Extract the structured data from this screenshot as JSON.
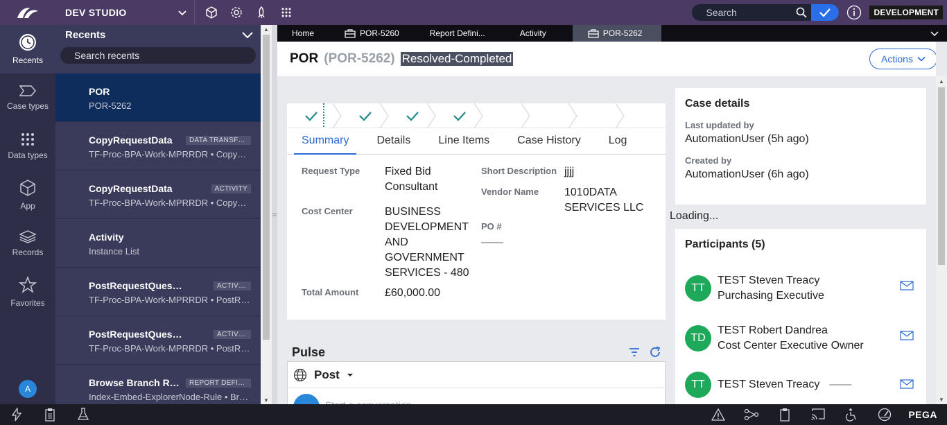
{
  "colors": {
    "topbar": "#4a3a64",
    "rail": "#2e2e48",
    "recents_panel": "#3a3b5a",
    "active_item": "#0f2d5c",
    "accent": "#2b6ad4",
    "participant_avatar": "#1ea85a",
    "status_badge": "#4b5060"
  },
  "header": {
    "studio_name": "DEV STUDIO",
    "search_placeholder": "Search",
    "env_badge": "DEVELOPMENT",
    "icons": [
      "cube-icon",
      "gear-icon",
      "rocket-icon",
      "grid-icon"
    ]
  },
  "rail": {
    "items": [
      {
        "label": "Recents",
        "icon": "clock-icon"
      },
      {
        "label": "Case types",
        "icon": "case-type-icon"
      },
      {
        "label": "Data types",
        "icon": "grid-dots-icon"
      },
      {
        "label": "App",
        "icon": "cube-icon"
      },
      {
        "label": "Records",
        "icon": "layers-icon"
      },
      {
        "label": "Favorites",
        "icon": "star-icon"
      }
    ],
    "avatar_initial": "A"
  },
  "recents": {
    "title": "Recents",
    "search_placeholder": "Search recents",
    "items": [
      {
        "title": "POR",
        "subtitle": "POR-5262",
        "badge": ""
      },
      {
        "title": "CopyRequestData",
        "subtitle": "TF-Proc-BPA-Work-MPRRDR • CopyRequestData",
        "badge": "DATA TRANSFORM"
      },
      {
        "title": "CopyRequestData",
        "subtitle": "TF-Proc-BPA-Work-MPRRDR • CopyRequestData",
        "badge": "ACTIVITY"
      },
      {
        "title": "Activity",
        "subtitle": "Instance List",
        "badge": ""
      },
      {
        "title": "PostRequestQuestionnaire",
        "subtitle": "TF-Proc-BPA-Work-MPRRDR • PostRequestQuestionnaire",
        "badge": "ACTIVITY"
      },
      {
        "title": "PostRequestQuestionnaire",
        "subtitle": "TF-Proc-BPA-Work-MPRRDR • PostRequestQuestionnaire",
        "badge": "ACTIVITY"
      },
      {
        "title": "Browse Branch Rules",
        "subtitle": "Index-Embed-ExplorerNode-Rule • Browse",
        "badge": "REPORT DEFINITION"
      }
    ]
  },
  "worktabs": [
    {
      "label": "Home",
      "icon": ""
    },
    {
      "label": "POR-5260",
      "icon": "briefcase-icon"
    },
    {
      "label": "Report Defini...",
      "icon": ""
    },
    {
      "label": "Activity",
      "icon": ""
    },
    {
      "label": "POR-5262",
      "icon": "briefcase-icon"
    }
  ],
  "case": {
    "title": "POR",
    "id": "(POR-5262)",
    "status": "Resolved-Completed",
    "actions_label": "Actions"
  },
  "stages": {
    "completed": 4,
    "total": 7
  },
  "tabs": [
    "Summary",
    "Details",
    "Line Items",
    "Case History",
    "Log"
  ],
  "summary": {
    "request_type_label": "Request Type",
    "request_type_value1": "Fixed Bid",
    "request_type_value2": "Consultant",
    "cost_center_label": "Cost Center",
    "cost_center_lines": [
      "BUSINESS",
      "DEVELOPMENT",
      "AND",
      "GOVERNMENT",
      "SERVICES - 480"
    ],
    "total_amount_label": "Total Amount",
    "total_amount_value": "£60,000.00",
    "short_desc_label": "Short Description",
    "short_desc_value": "jjjj",
    "vendor_label": "Vendor Name",
    "vendor_line1": "1010DATA",
    "vendor_line2": "SERVICES LLC",
    "po_label": "PO #",
    "po_value": "——"
  },
  "pulse": {
    "title": "Pulse",
    "post_label": "Post",
    "placeholder": "Start a conversation"
  },
  "case_details": {
    "title": "Case details",
    "last_updated_label": "Last updated by",
    "last_updated_value": "AutomationUser (5h ago)",
    "created_label": "Created by",
    "created_value": "AutomationUser (6h ago)"
  },
  "loading_text": "Loading...",
  "participants": {
    "title": "Participants (5)",
    "items": [
      {
        "initials": "TT",
        "name": "TEST Steven Treacy",
        "role": "Purchasing Executive"
      },
      {
        "initials": "TD",
        "name": "TEST Robert Dandrea",
        "role": "Cost Center Executive Owner"
      },
      {
        "initials": "TT",
        "name": "TEST Steven Treacy",
        "role": "——"
      }
    ]
  },
  "bottombar": {
    "brand": "PEGA"
  }
}
